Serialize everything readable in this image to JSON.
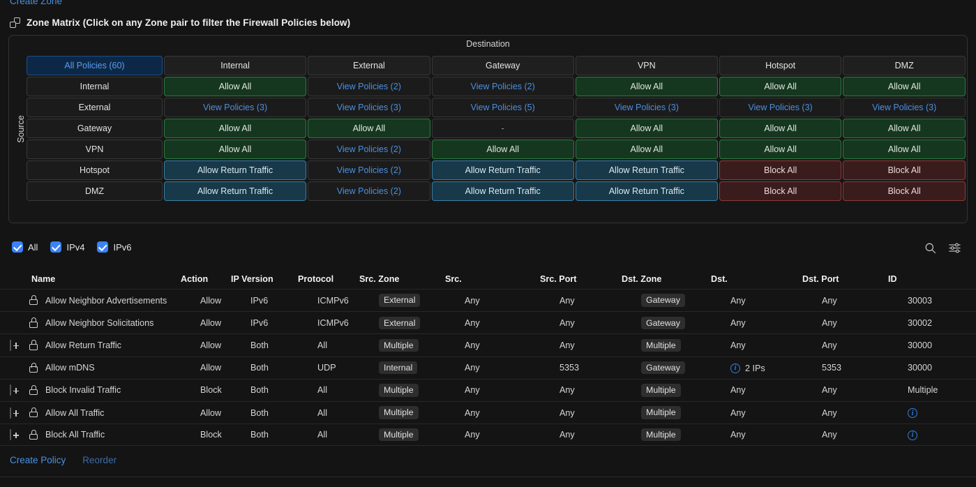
{
  "top_link": {
    "label": "Create Zone"
  },
  "section": {
    "icon": "layers-icon",
    "title": "Zone Matrix (Click on any Zone pair to filter the Firewall Policies below)"
  },
  "matrix": {
    "destination_label": "Destination",
    "source_label": "Source",
    "selected_cell": "All Policies (60)",
    "columns": [
      "Internal",
      "External",
      "Gateway",
      "VPN",
      "Hotspot",
      "DMZ"
    ],
    "rows": [
      {
        "source": "Internal",
        "cells": [
          {
            "text": "Allow All",
            "kind": "allow"
          },
          {
            "text": "View Policies (2)",
            "kind": "link"
          },
          {
            "text": "View Policies (2)",
            "kind": "link"
          },
          {
            "text": "Allow All",
            "kind": "allow"
          },
          {
            "text": "Allow All",
            "kind": "allow"
          },
          {
            "text": "Allow All",
            "kind": "allow"
          }
        ]
      },
      {
        "source": "External",
        "cells": [
          {
            "text": "View Policies (3)",
            "kind": "link"
          },
          {
            "text": "View Policies (3)",
            "kind": "link"
          },
          {
            "text": "View Policies (5)",
            "kind": "link"
          },
          {
            "text": "View Policies (3)",
            "kind": "link"
          },
          {
            "text": "View Policies (3)",
            "kind": "link"
          },
          {
            "text": "View Policies (3)",
            "kind": "link"
          }
        ]
      },
      {
        "source": "Gateway",
        "cells": [
          {
            "text": "Allow All",
            "kind": "allow"
          },
          {
            "text": "Allow All",
            "kind": "allow"
          },
          {
            "text": "-",
            "kind": "none"
          },
          {
            "text": "Allow All",
            "kind": "allow"
          },
          {
            "text": "Allow All",
            "kind": "allow"
          },
          {
            "text": "Allow All",
            "kind": "allow"
          }
        ]
      },
      {
        "source": "VPN",
        "cells": [
          {
            "text": "Allow All",
            "kind": "allow"
          },
          {
            "text": "View Policies (2)",
            "kind": "link"
          },
          {
            "text": "Allow All",
            "kind": "allow"
          },
          {
            "text": "Allow All",
            "kind": "allow"
          },
          {
            "text": "Allow All",
            "kind": "allow"
          },
          {
            "text": "Allow All",
            "kind": "allow"
          }
        ]
      },
      {
        "source": "Hotspot",
        "cells": [
          {
            "text": "Allow Return Traffic",
            "kind": "ret"
          },
          {
            "text": "View Policies (2)",
            "kind": "link"
          },
          {
            "text": "Allow Return Traffic",
            "kind": "ret"
          },
          {
            "text": "Allow Return Traffic",
            "kind": "ret"
          },
          {
            "text": "Block All",
            "kind": "block"
          },
          {
            "text": "Block All",
            "kind": "block"
          }
        ]
      },
      {
        "source": "DMZ",
        "cells": [
          {
            "text": "Allow Return Traffic",
            "kind": "ret"
          },
          {
            "text": "View Policies (2)",
            "kind": "link"
          },
          {
            "text": "Allow Return Traffic",
            "kind": "ret"
          },
          {
            "text": "Allow Return Traffic",
            "kind": "ret"
          },
          {
            "text": "Block All",
            "kind": "block"
          },
          {
            "text": "Block All",
            "kind": "block"
          }
        ]
      }
    ]
  },
  "filter_bar": {
    "checkboxes": [
      {
        "label": "All",
        "checked": true
      },
      {
        "label": "IPv4",
        "checked": true
      },
      {
        "label": "IPv6",
        "checked": true
      }
    ],
    "icons": [
      "search-icon",
      "filter-sliders-icon"
    ]
  },
  "policies": {
    "columns": [
      "Name",
      "Action",
      "IP Version",
      "Protocol",
      "Src. Zone",
      "Src.",
      "Src. Port",
      "Dst. Zone",
      "Dst.",
      "Dst. Port",
      "ID"
    ],
    "rows": [
      {
        "expandable": false,
        "locked": true,
        "name": "Allow Neighbor Advertisements",
        "action": "Allow",
        "ip_version": "IPv6",
        "protocol": "ICMPv6",
        "src_zone": "External",
        "src": "Any",
        "src_port": "Any",
        "dst_zone": "Gateway",
        "dst": "Any",
        "dst_port": "Any",
        "id": "30003",
        "dst_info": false,
        "id_info": false
      },
      {
        "expandable": false,
        "locked": true,
        "name": "Allow Neighbor Solicitations",
        "action": "Allow",
        "ip_version": "IPv6",
        "protocol": "ICMPv6",
        "src_zone": "External",
        "src": "Any",
        "src_port": "Any",
        "dst_zone": "Gateway",
        "dst": "Any",
        "dst_port": "Any",
        "id": "30002",
        "dst_info": false,
        "id_info": false
      },
      {
        "expandable": true,
        "locked": true,
        "name": "Allow Return Traffic",
        "action": "Allow",
        "ip_version": "Both",
        "protocol": "All",
        "src_zone": "Multiple",
        "src": "Any",
        "src_port": "Any",
        "dst_zone": "Multiple",
        "dst": "Any",
        "dst_port": "Any",
        "id": "30000",
        "dst_info": false,
        "id_info": false
      },
      {
        "expandable": false,
        "locked": true,
        "name": "Allow mDNS",
        "action": "Allow",
        "ip_version": "Both",
        "protocol": "UDP",
        "src_zone": "Internal",
        "src": "Any",
        "src_port": "5353",
        "dst_zone": "Gateway",
        "dst": "2 IPs",
        "dst_port": "5353",
        "id": "30000",
        "dst_info": true,
        "id_info": false
      },
      {
        "expandable": true,
        "locked": true,
        "name": "Block Invalid Traffic",
        "action": "Block",
        "ip_version": "Both",
        "protocol": "All",
        "src_zone": "Multiple",
        "src": "Any",
        "src_port": "Any",
        "dst_zone": "Multiple",
        "dst": "Any",
        "dst_port": "Any",
        "id": "Multiple",
        "dst_info": false,
        "id_info": false
      },
      {
        "expandable": true,
        "locked": true,
        "name": "Allow All Traffic",
        "action": "Allow",
        "ip_version": "Both",
        "protocol": "All",
        "src_zone": "Multiple",
        "src": "Any",
        "src_port": "Any",
        "dst_zone": "Multiple",
        "dst": "Any",
        "dst_port": "Any",
        "id": "",
        "dst_info": false,
        "id_info": true
      },
      {
        "expandable": true,
        "locked": true,
        "name": "Block All Traffic",
        "action": "Block",
        "ip_version": "Both",
        "protocol": "All",
        "src_zone": "Multiple",
        "src": "Any",
        "src_port": "Any",
        "dst_zone": "Multiple",
        "dst": "Any",
        "dst_port": "Any",
        "id": "",
        "dst_info": false,
        "id_info": true
      }
    ]
  },
  "footer": {
    "create_policy": "Create Policy",
    "reorder": "Reorder"
  },
  "colors": {
    "background": "#141414",
    "accent_blue": "#4a90e2",
    "checkbox_blue": "#3b82f6",
    "allow_green": "#16371f",
    "return_blue": "#17394a",
    "block_red": "#3a1c1c",
    "selected_navy": "#0d2847"
  }
}
